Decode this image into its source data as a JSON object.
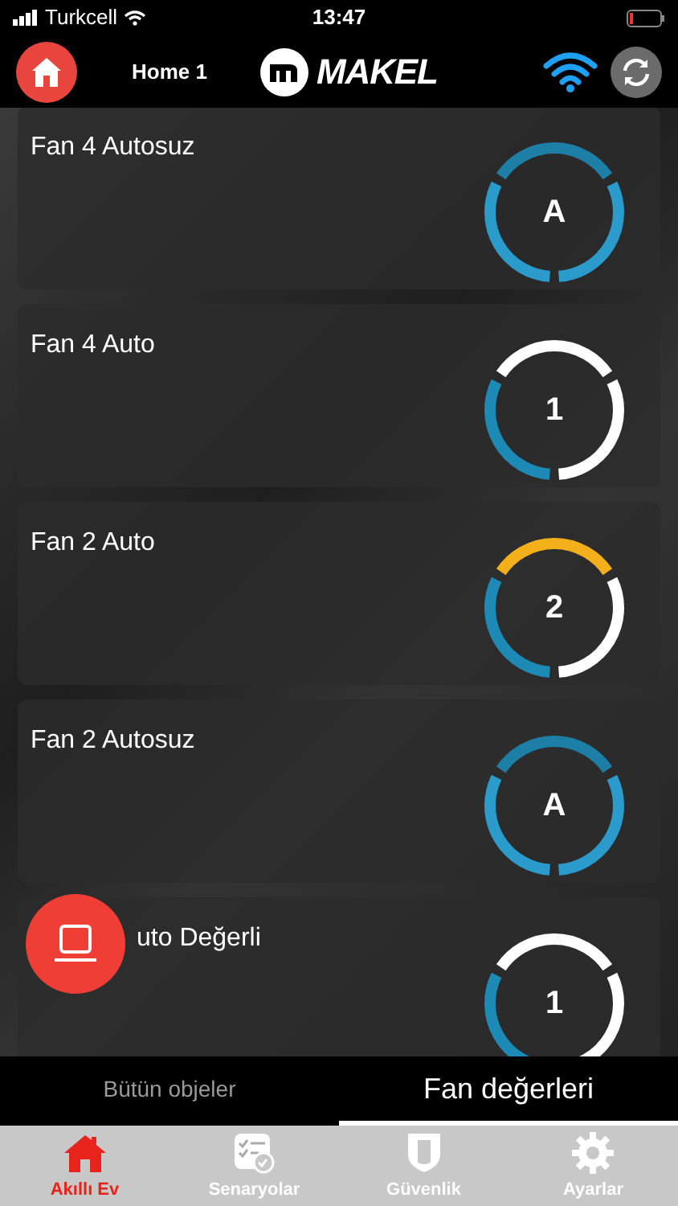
{
  "status_bar": {
    "carrier": "Turkcell",
    "time": "13:47"
  },
  "header": {
    "home_name": "Home 1",
    "logo": "MAKEL"
  },
  "cards": [
    {
      "title": "Fan 4 Autosuz",
      "value": "A",
      "segments": [
        {
          "color": "#2a9bcb"
        },
        {
          "color": "#1d7fa6"
        },
        {
          "color": "#2a9bcb"
        }
      ]
    },
    {
      "title": "Fan 4 Auto",
      "value": "1",
      "segments": [
        {
          "color": "#1d8ab5"
        },
        {
          "color": "#ffffff"
        },
        {
          "color": "#ffffff"
        }
      ]
    },
    {
      "title": "Fan 2 Auto",
      "value": "2",
      "segments": [
        {
          "color": "#1d8ab5"
        },
        {
          "color": "#f3b01b"
        },
        {
          "color": "#ffffff"
        }
      ]
    },
    {
      "title": "Fan 2 Autosuz",
      "value": "A",
      "segments": [
        {
          "color": "#2a9bcb"
        },
        {
          "color": "#1d7fa6"
        },
        {
          "color": "#2a9bcb"
        }
      ]
    },
    {
      "title": "uto Değerli",
      "value": "1",
      "segments": [
        {
          "color": "#1d8ab5"
        },
        {
          "color": "#ffffff"
        },
        {
          "color": "#ffffff"
        }
      ]
    }
  ],
  "tabs": [
    {
      "label": "Bütün objeler",
      "selected": false
    },
    {
      "label": "Fan değerleri",
      "selected": true
    }
  ],
  "nav": [
    {
      "label": "Akıllı Ev",
      "kind": "home",
      "selected": true
    },
    {
      "label": "Senaryolar",
      "kind": "scenarios",
      "selected": false
    },
    {
      "label": "Güvenlik",
      "kind": "security",
      "selected": false
    },
    {
      "label": "Ayarlar",
      "kind": "settings",
      "selected": false
    }
  ]
}
